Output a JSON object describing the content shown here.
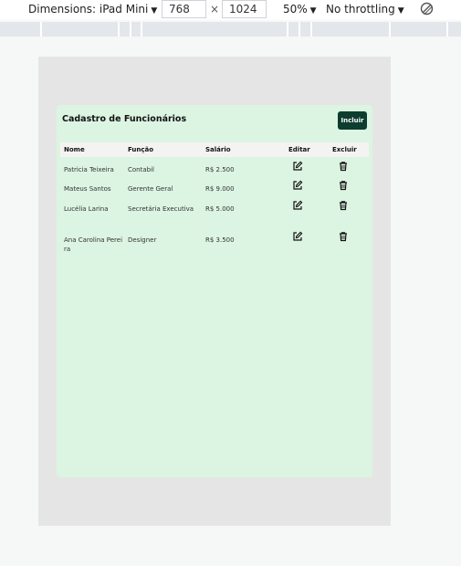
{
  "devtools": {
    "dimensions_label": "Dimensions: iPad Mini",
    "width": "768",
    "times": "×",
    "height": "1024",
    "zoom": "50%",
    "throttling": "No throttling",
    "rotate_icon": "rotate-icon"
  },
  "app": {
    "title": "Cadastro de Funcionários",
    "add_button": "Incluir",
    "columns": {
      "name": "Nome",
      "role": "Função",
      "salary": "Salário",
      "edit": "Editar",
      "delete": "Excluir"
    },
    "rows": [
      {
        "name": "Patricia Teixeira",
        "role": "Contabil",
        "salary": "R$ 2.500"
      },
      {
        "name": "Mateus Santos",
        "role": "Gerente Geral",
        "salary": "R$ 9.000"
      },
      {
        "name": "Lucélia Larina",
        "role": "Secretária Executiva",
        "salary": "R$ 5.000"
      },
      {
        "name": "Ana Carolina Pereira",
        "role": "Designer",
        "salary": "R$ 3.500"
      }
    ],
    "edit_icon": "edit-icon",
    "delete_icon": "trash-icon",
    "colors": {
      "card_bg": "#dcf4e2",
      "button_bg": "#0d3d2f",
      "header_bg": "#f5f3f2",
      "viewport_bg": "#e5e5e5"
    }
  }
}
